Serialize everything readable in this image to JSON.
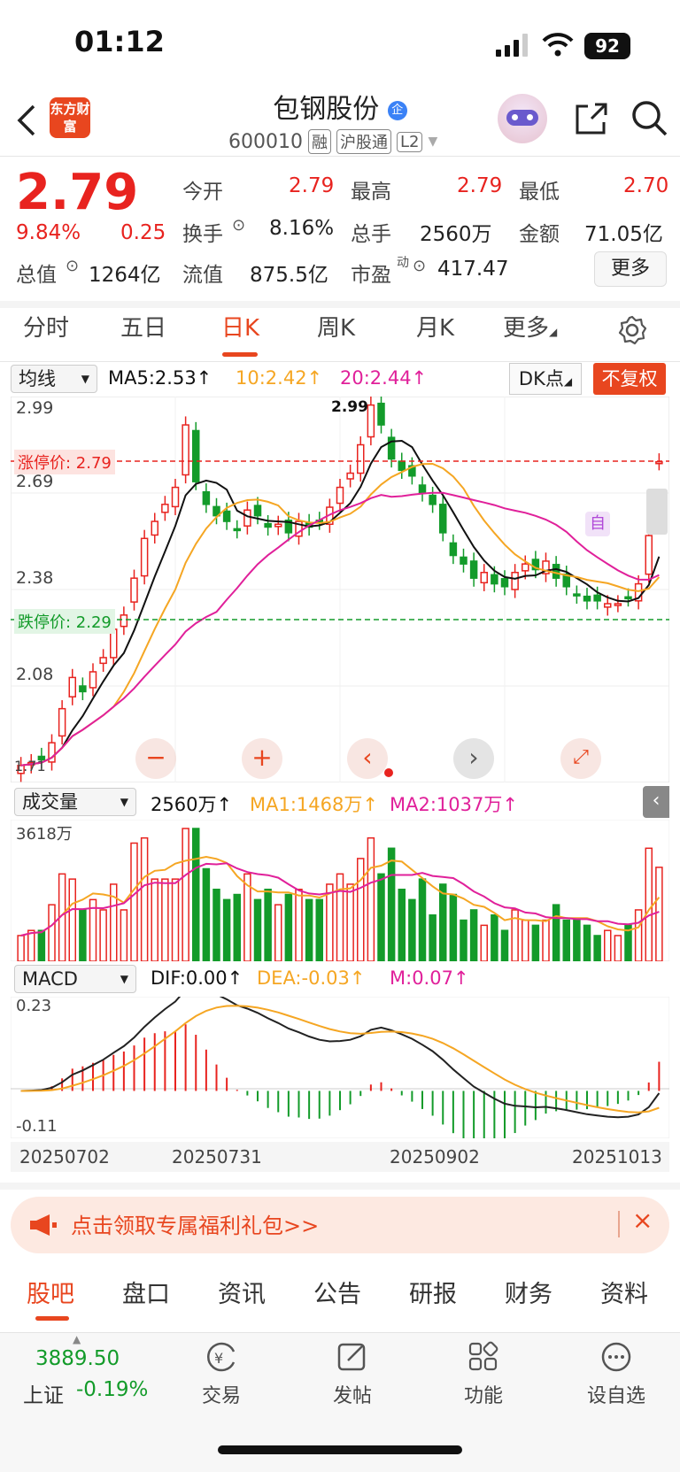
{
  "status": {
    "time": "01:12",
    "battery": "92"
  },
  "header": {
    "logo_text": "东方财富",
    "title": "包钢股份",
    "code": "600010",
    "tags": [
      "融",
      "沪股通",
      "L2"
    ]
  },
  "quote": {
    "price": "2.79",
    "change_pct": "9.84%",
    "change": "0.25",
    "open_label": "今开",
    "open": "2.79",
    "high_label": "最高",
    "high": "2.79",
    "low_label": "最低",
    "low": "2.70",
    "turnover_label": "换手",
    "turnover": "8.16%",
    "volume_label": "总手",
    "volume": "2560万",
    "amount_label": "金额",
    "amount": "71.05亿",
    "mktcap_label": "总值",
    "mktcap": "1264亿",
    "float_label": "流值",
    "float_cap": "875.5亿",
    "pe_label": "市盈",
    "pe_sup": "动",
    "pe": "417.47",
    "more": "更多"
  },
  "tabs": [
    "分时",
    "五日",
    "日K",
    "周K",
    "月K",
    "更多"
  ],
  "chart_controls": {
    "ma_select": "均线",
    "ma5": "MA5:2.53↑",
    "ma10": "10:2.42↑",
    "ma20": "20:2.44↑",
    "dk": "DK点",
    "adjust": "不复权"
  },
  "price_chart": {
    "y_labels": [
      "2.99",
      "2.69",
      "2.38",
      "2.08"
    ],
    "limit_up_label": "涨停价: 2.79",
    "limit_down_label": "跌停价: 2.29",
    "peak_label": "2.99",
    "self_label": "自",
    "bottom_label": "1.71"
  },
  "volume": {
    "select": "成交量",
    "value": "2560万↑",
    "ma1": "MA1:1468万↑",
    "ma2": "MA2:1037万↑",
    "max_label": "3618万"
  },
  "macd": {
    "select": "MACD",
    "dif": "DIF:0.00↑",
    "dea": "DEA:-0.03↑",
    "m": "M:0.07↑",
    "top_label": "0.23",
    "bottom_label": "-0.11"
  },
  "dates": [
    "20250702",
    "20250731",
    "20250902",
    "20251013"
  ],
  "promo": {
    "text": "点击领取专属福利礼包>>"
  },
  "bottom_tabs": [
    "股吧",
    "盘口",
    "资讯",
    "公告",
    "研报",
    "财务",
    "资料"
  ],
  "footer": {
    "index_value": "3889.50",
    "index_name": "上证",
    "index_change": "-0.19%",
    "items": [
      "交易",
      "发帖",
      "功能",
      "设自选"
    ]
  },
  "colors": {
    "up": "#e8231f",
    "down": "#139b2a",
    "accent": "#e8461f",
    "ma5": "#111111",
    "ma10": "#f5a623",
    "ma20": "#e0209a"
  },
  "chart_data": {
    "type": "candlestick",
    "closes": [
      1.72,
      1.73,
      1.74,
      1.8,
      1.92,
      2.03,
      1.98,
      2.05,
      2.1,
      2.2,
      2.25,
      2.38,
      2.52,
      2.58,
      2.64,
      2.7,
      2.92,
      2.72,
      2.64,
      2.6,
      2.58,
      2.55,
      2.62,
      2.6,
      2.56,
      2.57,
      2.54,
      2.58,
      2.56,
      2.58,
      2.63,
      2.7,
      2.75,
      2.85,
      2.99,
      2.92,
      2.8,
      2.76,
      2.74,
      2.68,
      2.64,
      2.54,
      2.46,
      2.43,
      2.38,
      2.4,
      2.36,
      2.35,
      2.4,
      2.43,
      2.41,
      2.44,
      2.38,
      2.35,
      2.32,
      2.3,
      2.3,
      2.29,
      2.29,
      2.31,
      2.36,
      2.53,
      2.79
    ],
    "ma_legend": [
      "MA5:2.53↑",
      "10:2.42↑",
      "20:2.44↑"
    ]
  }
}
